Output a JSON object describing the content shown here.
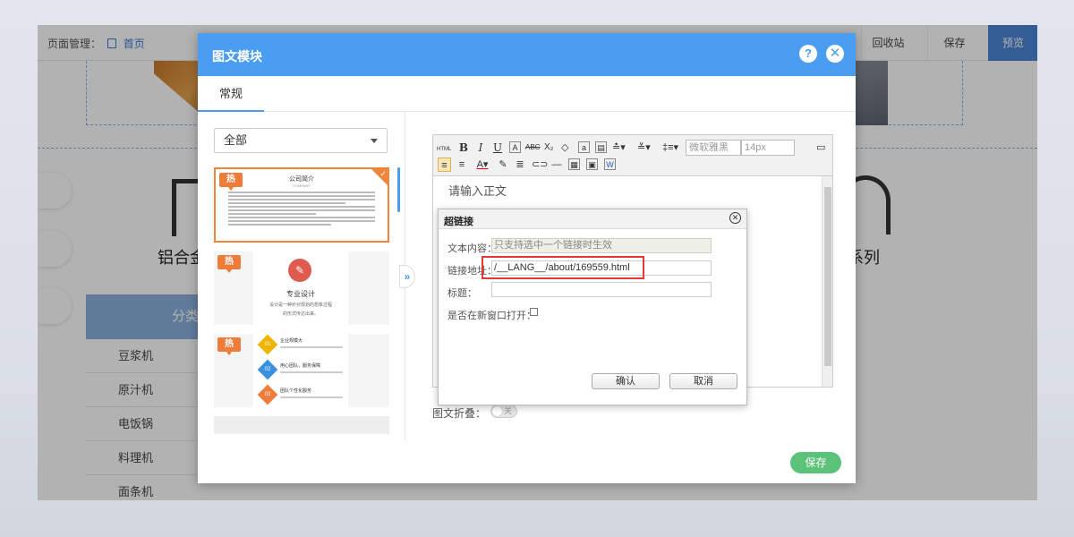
{
  "editor_topbar": {
    "breadcrumb_label": "页面管理：",
    "home_label": "首页",
    "recycle_label": "回收站",
    "save_label": "保存",
    "preview_label": "预览"
  },
  "background": {
    "category_left": "铝合金",
    "category_right": "窗系列",
    "category_list_header": "分类",
    "category_items": [
      "豆浆机",
      "原汁机",
      "电饭锅",
      "料理机",
      "面条机"
    ]
  },
  "modal": {
    "title": "图文模块",
    "help_label": "?",
    "close_label": "✕",
    "tab_label": "常规",
    "filter_value": "全部",
    "hot_label": "热",
    "template1": {
      "title": "公司简介",
      "subtitle": "COMPANY"
    },
    "template2": {
      "title": "专业设计",
      "desc1": "设计是一种针对规划的想象过程",
      "desc2": "的形式传达出来。"
    },
    "template3": {
      "items": [
        {
          "num": "01",
          "title": "企业规模大",
          "color": "#f0b400"
        },
        {
          "num": "02",
          "title": "用心团队，服务保障",
          "color": "#3a90e0"
        },
        {
          "num": "03",
          "title": "团队个性化服务",
          "color": "#f07c3a"
        }
      ]
    },
    "toggle_label": "»",
    "editor": {
      "html_label": "HTML",
      "font_family": "微软雅黑",
      "font_size": "14px",
      "placeholder": "请输入正文"
    },
    "fold_label": "图文折叠：",
    "fold_switch_label": "关",
    "save_label": "保存"
  },
  "link_dialog": {
    "title": "超链接",
    "close_label": "✕",
    "text_label": "文本内容：",
    "text_value": "只支持选中一个链接时生效",
    "url_label": "链接地址：",
    "url_value": "/__LANG__/about/169559.html",
    "title_label": "标题：",
    "title_value": "",
    "newwin_label": "是否在新窗口打开：",
    "ok_label": "确认",
    "cancel_label": "取消"
  },
  "colors": {
    "header_blue": "#4a9df0",
    "hot_orange": "#f07c3a",
    "save_green": "#5cc27a",
    "highlight_red": "#e53935"
  }
}
